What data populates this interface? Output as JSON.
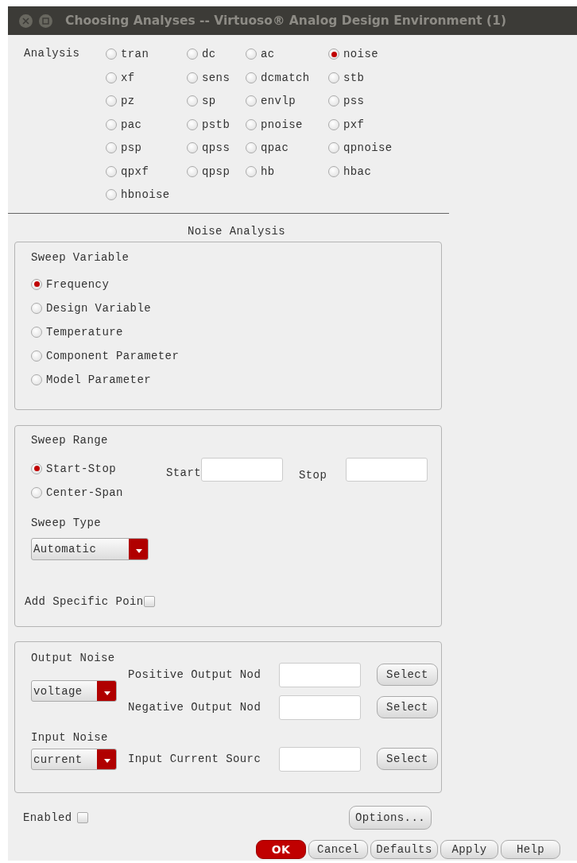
{
  "window": {
    "title": "Choosing Analyses -- Virtuoso® Analog Design Environment (1)"
  },
  "analysis": {
    "label": "Analysis",
    "options": [
      {
        "label": "tran",
        "selected": false
      },
      {
        "label": "dc",
        "selected": false
      },
      {
        "label": "ac",
        "selected": false
      },
      {
        "label": "noise",
        "selected": true
      },
      {
        "label": "xf",
        "selected": false
      },
      {
        "label": "sens",
        "selected": false
      },
      {
        "label": "dcmatch",
        "selected": false
      },
      {
        "label": "stb",
        "selected": false
      },
      {
        "label": "pz",
        "selected": false
      },
      {
        "label": "sp",
        "selected": false
      },
      {
        "label": "envlp",
        "selected": false
      },
      {
        "label": "pss",
        "selected": false
      },
      {
        "label": "pac",
        "selected": false
      },
      {
        "label": "pstb",
        "selected": false
      },
      {
        "label": "pnoise",
        "selected": false
      },
      {
        "label": "pxf",
        "selected": false
      },
      {
        "label": "psp",
        "selected": false
      },
      {
        "label": "qpss",
        "selected": false
      },
      {
        "label": "qpac",
        "selected": false
      },
      {
        "label": "qpnoise",
        "selected": false
      },
      {
        "label": "qpxf",
        "selected": false
      },
      {
        "label": "qpsp",
        "selected": false
      },
      {
        "label": "hb",
        "selected": false
      },
      {
        "label": "hbac",
        "selected": false
      },
      {
        "label": "hbnoise",
        "selected": false
      }
    ]
  },
  "section_title": "Noise Analysis",
  "sweep_variable": {
    "title": "Sweep Variable",
    "options": [
      {
        "label": "Frequency",
        "selected": true
      },
      {
        "label": "Design Variable",
        "selected": false
      },
      {
        "label": "Temperature",
        "selected": false
      },
      {
        "label": "Component Parameter",
        "selected": false
      },
      {
        "label": "Model Parameter",
        "selected": false
      }
    ]
  },
  "sweep_range": {
    "title": "Sweep Range",
    "options": [
      {
        "label": "Start-Stop",
        "selected": true
      },
      {
        "label": "Center-Span",
        "selected": false
      }
    ],
    "fields": [
      {
        "label": "Start"
      },
      {
        "label": "Stop"
      }
    ],
    "sweep_type": {
      "label": "Sweep Type",
      "value": "Automatic"
    },
    "add_specific_points": {
      "label": "Add Specific Poin",
      "checked": false
    }
  },
  "output_noise": {
    "title": "Output Noise",
    "type": "voltage",
    "rows": [
      {
        "label": "Positive Output Nod",
        "button": "Select"
      },
      {
        "label": "Negative Output Nod",
        "button": "Select"
      }
    ]
  },
  "input_noise": {
    "title": "Input Noise",
    "type": "current",
    "rows": [
      {
        "label": "Input Current Sourc",
        "button": "Select"
      }
    ]
  },
  "enabled": {
    "label": "Enabled",
    "checked": false
  },
  "options_button": "Options...",
  "buttons": [
    {
      "label": "OK",
      "kind": "primary"
    },
    {
      "label": "Cancel",
      "kind": "normal"
    },
    {
      "label": "Defaults",
      "kind": "normal"
    },
    {
      "label": "Apply",
      "kind": "normal"
    },
    {
      "label": "Help",
      "kind": "normal"
    }
  ]
}
